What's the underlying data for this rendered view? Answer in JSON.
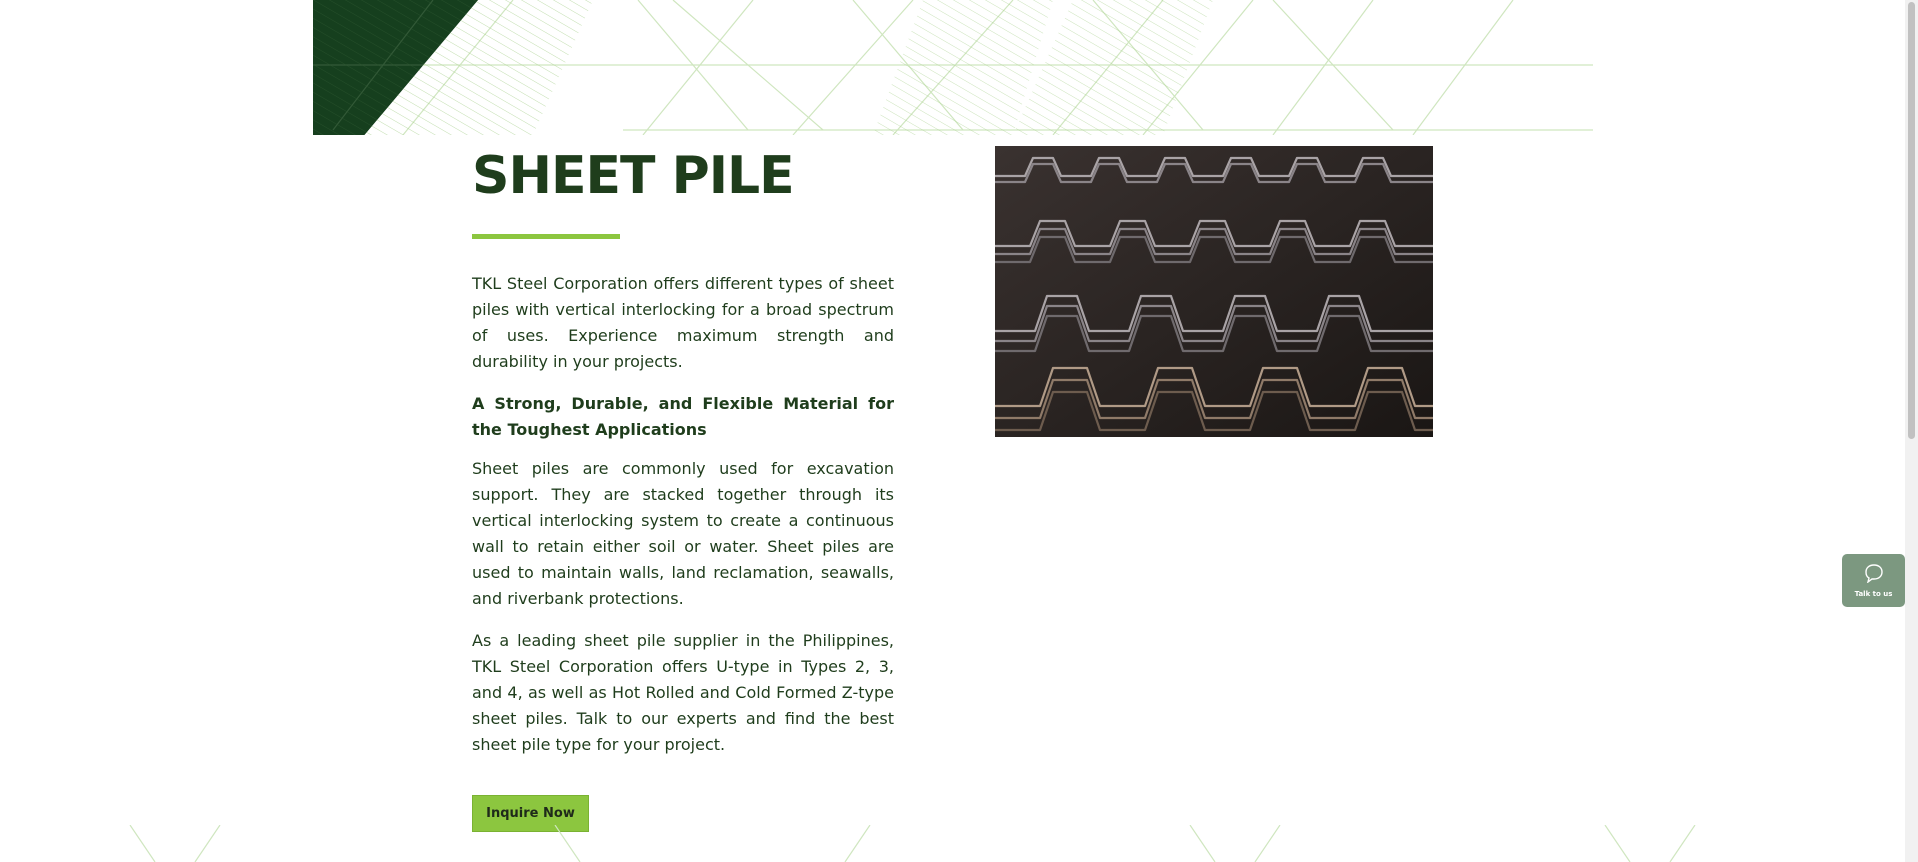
{
  "page": {
    "title": "SHEET PILE",
    "intro": "TKL Steel Corporation offers different types of sheet piles with vertical interlocking for a broad spectrum of uses. Experience maximum strength and durability in your projects.",
    "subheading": "A Strong, Durable, and Flexible Material for the Toughest Applications",
    "body_1": "Sheet piles are commonly used for excavation support. They are stacked together through its vertical interlocking system to create a continuous wall to retain either soil or water. Sheet piles are used to maintain walls, land reclamation, seawalls, and riverbank protections.",
    "body_2": "As a leading sheet pile supplier in the Philippines, TKL Steel Corporation offers U-type in Types 2, 3, and 4, as well as Hot Rolled and Cold Formed Z-type sheet piles. Talk to our experts and find the best sheet pile type for your project.",
    "cta_label": "Inquire Now"
  },
  "widget": {
    "label": "Talk to us",
    "icon": "chat-bubble-icon"
  },
  "colors": {
    "dark_green": "#1f3d1c",
    "accent_green": "#8cc63f",
    "banner_green": "#163f1e",
    "widget_bg": "#7c9880"
  }
}
